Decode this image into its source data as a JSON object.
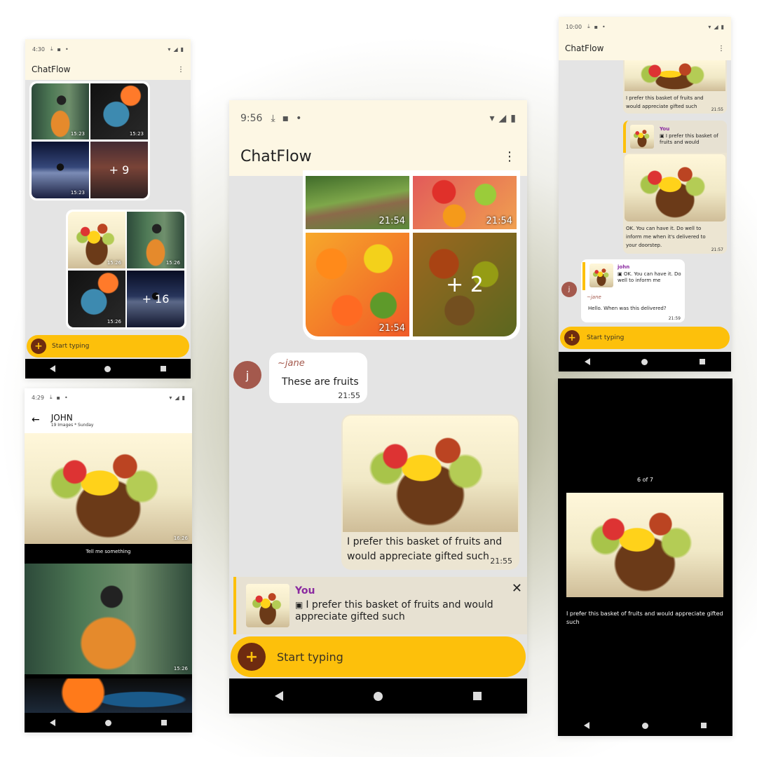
{
  "app": {
    "title": "ChatFlow",
    "menu_icon": "more-vert-icon"
  },
  "colors": {
    "accent": "#fdc00b",
    "plus_button": "#6e2b10",
    "appbar": "#fdf7e4",
    "you_name": "#8a2aa0",
    "avatar": "#a4594d"
  },
  "phone_left_top": {
    "time": "4:30",
    "app_title": "ChatFlow",
    "grid1_times": [
      "15:23",
      "15:23",
      "15:23"
    ],
    "grid1_more": "+ 9",
    "grid2_times": [
      "15:26",
      "15:26",
      "15:26"
    ],
    "grid2_more": "+ 16",
    "composer_placeholder": "Start typing"
  },
  "phone_left_bottom": {
    "time": "4:29",
    "title": "JOHN",
    "subtitle": "19 Images * Sunday",
    "img1_time": "16:26",
    "img1_caption": "Tell me something",
    "img2_time": "15:26"
  },
  "phone_center": {
    "time": "9:56",
    "app_title": "ChatFlow",
    "grid_times": [
      "21:54",
      "21:54",
      "21:54"
    ],
    "grid_more": "+ 2",
    "jane_avatar": "j",
    "jane_name": "~jane",
    "jane_text": "These are fruits",
    "jane_time": "21:55",
    "out_text": "I prefer this basket of fruits and would appreciate gifted such",
    "out_time": "21:55",
    "reply_name": "You",
    "reply_text": "I prefer this basket of fruits and would appreciate gifted such",
    "composer_placeholder": "Start typing"
  },
  "phone_right_top": {
    "time": "10:00",
    "app_title": "ChatFlow",
    "msg1_text": "I prefer this basket of fruits and would appreciate gifted such",
    "msg1_time": "21:55",
    "msg2_reply_name": "You",
    "msg2_reply_text": "I prefer this basket of fruits and would",
    "msg2_text": "OK. You can have it. Do well to inform me when it's delivered to your doorstep.",
    "msg2_time": "21:57",
    "msg3_reply_name": "john",
    "msg3_reply_text": "OK. You can have it. Do well to inform me",
    "msg3_author": "~jane",
    "msg3_text": "Hello. When was this delivered?",
    "msg3_time": "21:59",
    "avatar": "j",
    "composer_placeholder": "Start typing"
  },
  "phone_right_bottom": {
    "counter": "6 of 7",
    "caption": "I prefer this basket of fruits and would appreciate gifted such"
  }
}
